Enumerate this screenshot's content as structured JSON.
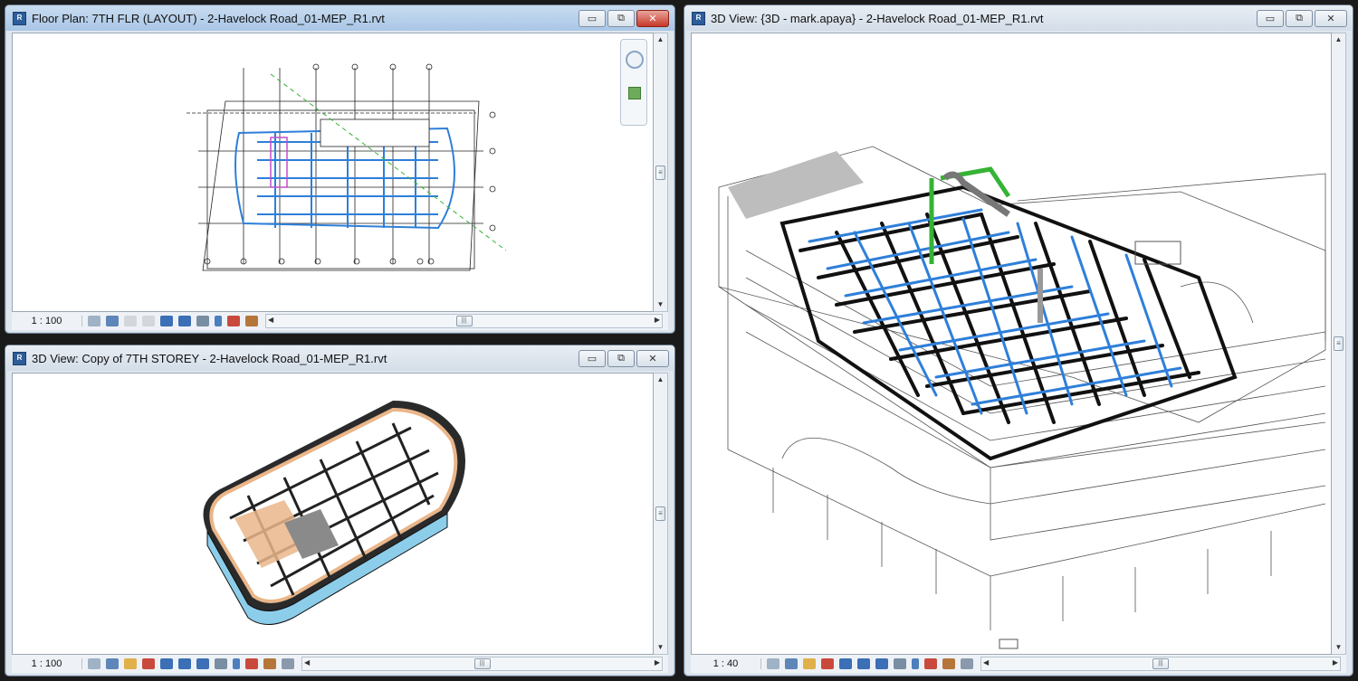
{
  "app_icon_letter": "R",
  "windows": {
    "floor_plan": {
      "title": "Floor Plan: 7TH FLR (LAYOUT) - 2-Havelock Road_01-MEP_R1.rvt",
      "scale": "1 : 100"
    },
    "storey_3d": {
      "title": "3D View: Copy of 7TH STOREY - 2-Havelock Road_01-MEP_R1.rvt",
      "scale": "1 : 100"
    },
    "main_3d": {
      "title": "3D View: {3D - mark.apaya} - 2-Havelock Road_01-MEP_R1.rvt",
      "scale": "1 : 40"
    }
  },
  "controls": {
    "minimize": "▭",
    "restore": "⧉",
    "close": "✕"
  },
  "scroll": {
    "up": "▲",
    "down": "▼",
    "left": "◀",
    "right": "▶",
    "grip": "|||",
    "vgrip": "≡"
  },
  "colors": {
    "duct_blue": "#2e7fd9",
    "pipe_black": "#111111",
    "orange_floor": "#e9b68a",
    "green_pipe": "#35b335"
  }
}
